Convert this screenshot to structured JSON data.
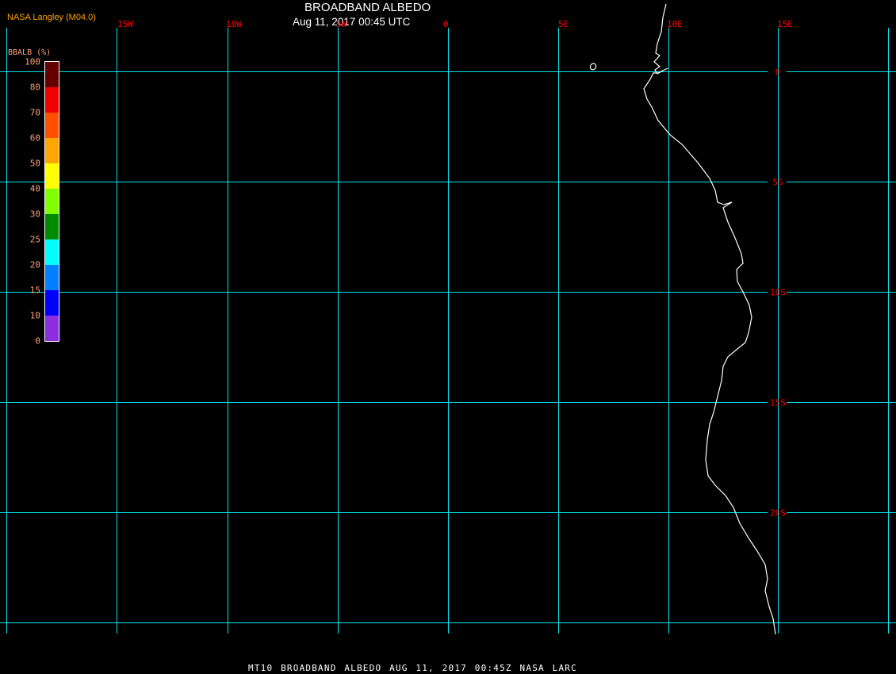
{
  "header": {
    "title": "BROADBAND ALBEDO",
    "subtitle": "Aug 11, 2017 00:45 UTC",
    "producer": "NASA Langley (M04.0)",
    "producer_color": "#ffa500"
  },
  "map": {
    "grid_color": "#00e5ee",
    "coastline_color": "#ffffff",
    "label_color": "#ff0000",
    "longitude_labels": [
      "15W",
      "10W",
      "5W",
      "0",
      "5E",
      "10E",
      "15E"
    ],
    "latitude_labels": [
      "0",
      "5S",
      "10S",
      "15S",
      "20S"
    ]
  },
  "colorbar": {
    "title": "BBALB (%)",
    "label_color": "#ffa07a",
    "ticks": [
      "100",
      "80",
      "70",
      "60",
      "50",
      "40",
      "30",
      "25",
      "20",
      "15",
      "10",
      "0"
    ],
    "colors": [
      "#640000",
      "#f00000",
      "#ff5000",
      "#ffa500",
      "#ffff00",
      "#80ff00",
      "#008c00",
      "#00ffff",
      "#0080ff",
      "#0000ff",
      "#8c2ee0"
    ]
  },
  "footer": {
    "caption": "MT10  BROADBAND ALBEDO   AUG 11, 2017 00:45Z   NASA LARC"
  }
}
